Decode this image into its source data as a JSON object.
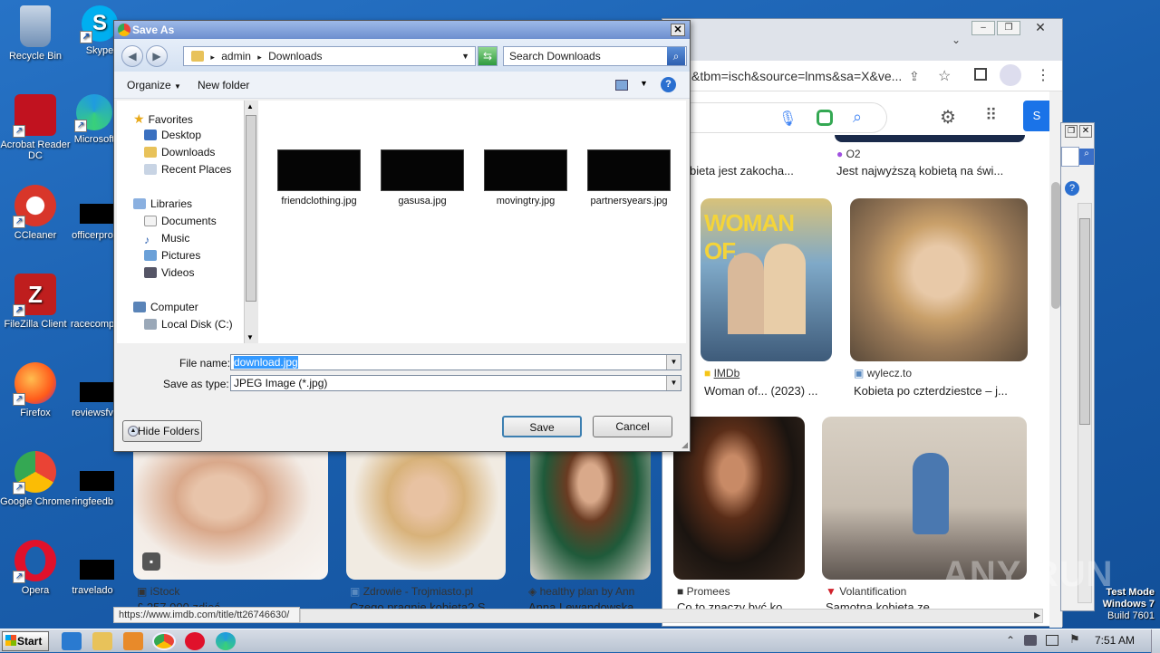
{
  "desktop": {
    "icons": [
      {
        "label": "Recycle Bin",
        "color": "#6f8fb5",
        "name": "recycle-bin-icon"
      },
      {
        "label": "Acrobat Reader DC",
        "color": "#c1121f",
        "name": "acrobat-reader-icon"
      },
      {
        "label": "CCleaner",
        "color": "#d8362a",
        "name": "ccleaner-icon"
      },
      {
        "label": "FileZilla Client",
        "color": "#bf1e1e",
        "name": "filezilla-icon"
      },
      {
        "label": "Firefox",
        "color": "#ff7a1a",
        "name": "firefox-icon"
      },
      {
        "label": "Google Chrome",
        "color": "#34a853",
        "name": "chrome-icon"
      },
      {
        "label": "Opera",
        "color": "#e0112b",
        "name": "opera-icon"
      }
    ],
    "icons2": [
      {
        "label": "Skype",
        "color": "#00aff0",
        "name": "skype-icon"
      },
      {
        "label": "Microsoft",
        "color": "#1f9be0",
        "name": "edge-icon"
      },
      {
        "label": "officerpro",
        "name": "file-officerpro"
      },
      {
        "label": "racecomp",
        "name": "file-racecomp"
      },
      {
        "label": "reviewsfv",
        "name": "file-reviewsfv"
      },
      {
        "label": "ringfeedb",
        "name": "file-ringfeedb"
      },
      {
        "label": "travelado",
        "name": "file-travelado"
      }
    ]
  },
  "browser": {
    "url": "&tbm=isch&source=lnms&sa=X&ve...",
    "top_captions": [
      "bieta jest zakocha...",
      "Jest najwyższą kobietą na świ..."
    ],
    "top_source": "O2",
    "mid": [
      {
        "source": "IMDb",
        "caption": "Woman of... (2023) ...",
        "poster_title": "WOMAN OF..."
      },
      {
        "source": "wylecz.to",
        "caption": "Kobieta po czterdziestce – j..."
      }
    ],
    "bottom_sources": [
      "iStock",
      "Zdrowie - Trojmiasto.pl",
      "healthy plan by Ann",
      "Promees",
      "Volantification"
    ],
    "bottom_captions": [
      "£ 257 000 zdjęć ...",
      "Czego pragnie kobieta? S...",
      "Anna Lewandowska",
      "Co to znaczy być ko...",
      "Samotna kobieta ze ..."
    ],
    "status_url": "https://www.imdb.com/title/tt26746630/"
  },
  "dialog": {
    "title": "Save As",
    "breadcrumb": [
      "admin",
      "Downloads"
    ],
    "search_placeholder": "Search Downloads",
    "organize": "Organize",
    "new_folder": "New folder",
    "nav": {
      "favorites": "Favorites",
      "desktop": "Desktop",
      "downloads": "Downloads",
      "recent": "Recent Places",
      "libraries": "Libraries",
      "documents": "Documents",
      "music": "Music",
      "pictures": "Pictures",
      "videos": "Videos",
      "computer": "Computer",
      "local_disk": "Local Disk (C:)"
    },
    "files": [
      "friendclothing.jpg",
      "gasusa.jpg",
      "movingtry.jpg",
      "partnersyears.jpg"
    ],
    "file_name_label": "File name:",
    "file_name_value": "download.jpg",
    "save_type_label": "Save as type:",
    "save_type_value": "JPEG Image (*.jpg)",
    "hide_folders": "Hide Folders",
    "save": "Save",
    "cancel": "Cancel"
  },
  "taskbar": {
    "start": "Start",
    "time": "7:51 AM"
  },
  "watermark": {
    "brand": "ANY RUN",
    "line1": "Test Mode",
    "line2": "Windows 7",
    "line3": "Build 7601"
  }
}
